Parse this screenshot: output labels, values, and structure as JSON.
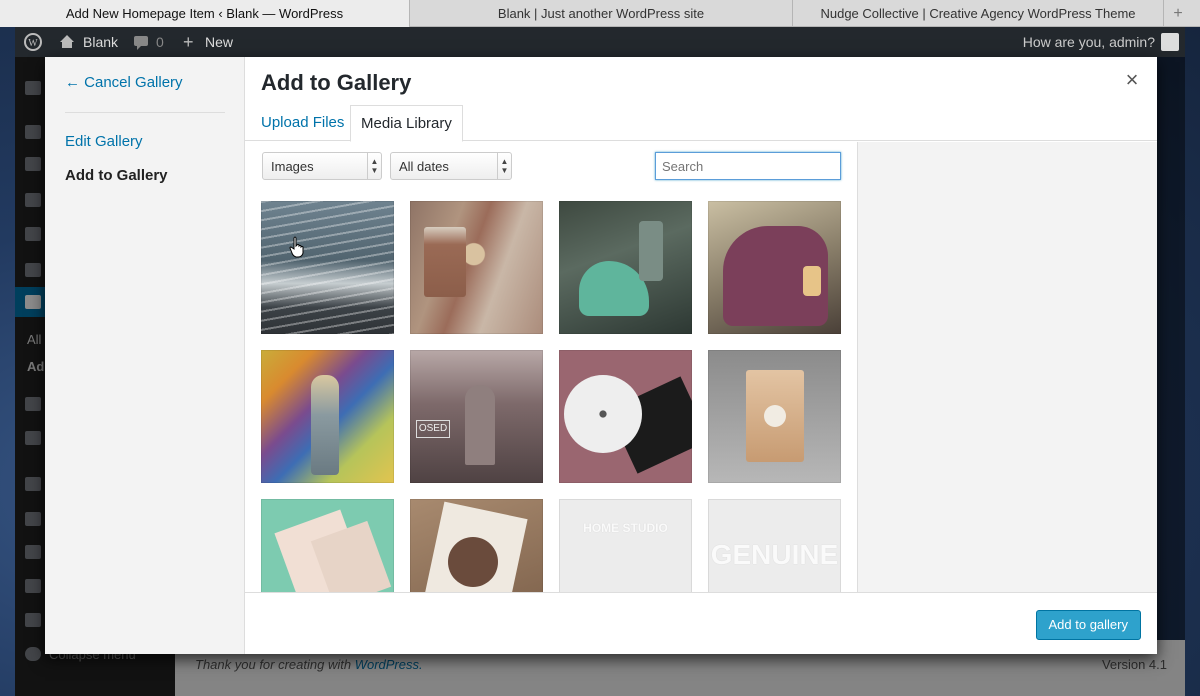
{
  "browser": {
    "tabs": [
      {
        "title": "Add New Homepage Item ‹ Blank — WordPress"
      },
      {
        "title": "Blank | Just another WordPress site"
      },
      {
        "title": "Nudge Collective | Creative Agency WordPress Theme"
      }
    ],
    "new_tab": "+"
  },
  "adminbar": {
    "site_name": "Blank",
    "comments_count": "0",
    "new_label": "New",
    "greeting": "How are you, admin?"
  },
  "wp_sidebar": {
    "all_label": "All",
    "add_label": "Ad",
    "collapse_label": "Collapse menu"
  },
  "footer": {
    "thanks_text": "Thank you for creating with",
    "wordpress_link": "WordPress.",
    "version": "Version 4.1"
  },
  "modal": {
    "menu": {
      "cancel": "← Cancel Gallery",
      "edit": "Edit Gallery",
      "add": "Add to Gallery"
    },
    "title": "Add to Gallery",
    "close": "×",
    "tabs": {
      "upload": "Upload Files",
      "library": "Media Library"
    },
    "filters": {
      "type": "Images",
      "date": "All dates"
    },
    "search": {
      "placeholder": "Search"
    },
    "button": "Add to gallery"
  },
  "media": [
    {
      "name": "ocean-waves"
    },
    {
      "name": "coffee-cookies"
    },
    {
      "name": "green-scooter"
    },
    {
      "name": "purple-scooter"
    },
    {
      "name": "graffiti-person"
    },
    {
      "name": "closed-shop-window"
    },
    {
      "name": "cd-packaging"
    },
    {
      "name": "coffee-bag"
    },
    {
      "name": "business-cards"
    },
    {
      "name": "el-gorcho-label"
    },
    {
      "name": "home-studio-logo",
      "text": "HOME STUDIO"
    },
    {
      "name": "genuine-brewing-logo",
      "text": "GENUINE"
    }
  ]
}
